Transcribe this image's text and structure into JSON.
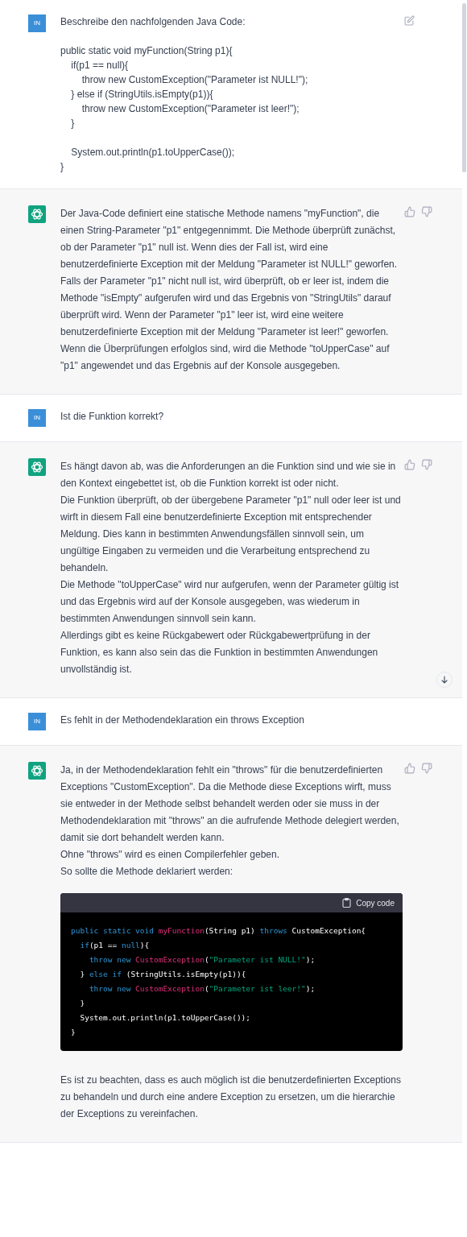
{
  "messages": [
    {
      "kind": "user",
      "avatar": "IN",
      "edit_icon": true,
      "lines": [
        "Beschreibe den nachfolgenden Java Code:"
      ],
      "code_groups": [
        [
          "public static void myFunction(String p1){",
          "    if(p1 == null){",
          "        throw new CustomException(\"Parameter ist NULL!\");",
          "    } else if (StringUtils.isEmpty(p1)){",
          "        throw new CustomException(\"Parameter ist leer!\");",
          "    }"
        ],
        [
          "    System.out.println(p1.toUpperCase());",
          "}"
        ]
      ]
    },
    {
      "kind": "assistant",
      "blocks": [
        {
          "kind": "paragraph",
          "lines": [
            "Der Java-Code definiert eine statische Methode namens \"myFunction\", die einen String-Parameter \"p1\" entgegennimmt. Die Methode überprüft zunächst, ob der Parameter \"p1\" null ist. Wenn dies der Fall ist, wird eine benutzerdefinierte Exception mit der Meldung \"Parameter ist NULL!\" geworfen. Falls der Parameter \"p1\" nicht null ist, wird überprüft, ob er leer ist, indem die Methode \"isEmpty\" aufgerufen wird und das Ergebnis von \"StringUtils\" darauf überprüft wird. Wenn der Parameter \"p1\" leer ist, wird eine weitere benutzerdefinierte Exception mit der Meldung \"Parameter ist leer!\" geworfen. Wenn die Überprüfungen erfolglos sind, wird die Methode \"toUpperCase\" auf \"p1\" angewendet und das Ergebnis auf der Konsole ausgegeben."
          ]
        }
      ]
    },
    {
      "kind": "user",
      "avatar": "IN",
      "edit_icon": false,
      "lines": [
        "Ist die Funktion korrekt?"
      ]
    },
    {
      "kind": "assistant",
      "scroll_button": true,
      "blocks": [
        {
          "kind": "paragraph",
          "lines": [
            "Es hängt davon ab, was die Anforderungen an die Funktion sind und wie sie in den Kontext eingebettet ist, ob die Funktion korrekt ist oder nicht.",
            "Die Funktion überprüft, ob der übergebene Parameter \"p1\" null oder leer ist und wirft in diesem Fall eine benutzerdefinierte Exception mit entsprechender Meldung. Dies kann in bestimmten Anwendungsfällen sinnvoll sein, um ungültige Eingaben zu vermeiden und die Verarbeitung entsprechend zu behandeln.",
            "Die Methode \"toUpperCase\" wird nur aufgerufen, wenn der Parameter gültig ist und das Ergebnis wird auf der Konsole ausgegeben, was wiederum in bestimmten Anwendungen sinnvoll sein kann.",
            "Allerdings gibt es keine Rückgabewert oder Rückgabewertprüfung in der Funktion, es kann also sein das die Funktion in bestimmten Anwendungen unvollständig ist."
          ]
        }
      ]
    },
    {
      "kind": "user",
      "avatar": "IN",
      "edit_icon": false,
      "lines": [
        "Es fehlt in der Methodendeklaration ein throws Exception"
      ]
    },
    {
      "kind": "assistant",
      "blocks": [
        {
          "kind": "paragraph",
          "lines": [
            "Ja, in der Methodendeklaration fehlt ein \"throws\" für die benutzerdefinierten Exceptions \"CustomException\". Da die Methode diese Exceptions wirft, muss sie entweder in der Methode selbst behandelt werden oder sie muss in der Methodendeklaration mit \"throws\" an die aufrufende Methode delegiert werden, damit sie dort behandelt werden kann.",
            "Ohne \"throws\" wird es einen Compilerfehler geben.",
            "So sollte die Methode deklariert werden:"
          ]
        },
        {
          "kind": "code",
          "copy_label": "Copy code",
          "code_lines": [
            [
              {
                "t": "public static void ",
                "kind": "keyword"
              },
              {
                "t": "myFunction",
                "kind": "name"
              },
              {
                "t": "(String p1) ",
                "kind": "plain"
              },
              {
                "t": "throws ",
                "kind": "keyword"
              },
              {
                "t": "CustomException{",
                "kind": "plain"
              }
            ],
            [
              {
                "t": "  if",
                "kind": "keyword"
              },
              {
                "t": "(p1 == ",
                "kind": "plain"
              },
              {
                "t": "null",
                "kind": "keyword"
              },
              {
                "t": "){",
                "kind": "plain"
              }
            ],
            [
              {
                "t": "    throw new ",
                "kind": "keyword"
              },
              {
                "t": "CustomException",
                "kind": "name"
              },
              {
                "t": "(",
                "kind": "plain"
              },
              {
                "t": "\"Parameter ist NULL!\"",
                "kind": "string"
              },
              {
                "t": ");",
                "kind": "plain"
              }
            ],
            [
              {
                "t": "  } ",
                "kind": "plain"
              },
              {
                "t": "else if ",
                "kind": "keyword"
              },
              {
                "t": "(StringUtils.isEmpty(p1)){",
                "kind": "plain"
              }
            ],
            [
              {
                "t": "    throw new ",
                "kind": "keyword"
              },
              {
                "t": "CustomException",
                "kind": "name"
              },
              {
                "t": "(",
                "kind": "plain"
              },
              {
                "t": "\"Parameter ist leer!\"",
                "kind": "string"
              },
              {
                "t": ");",
                "kind": "plain"
              }
            ],
            [
              {
                "t": "  }",
                "kind": "plain"
              }
            ],
            [
              {
                "t": "  System.out.println(p1.toUpperCase());",
                "kind": "plain"
              }
            ],
            [
              {
                "t": "}",
                "kind": "plain"
              }
            ]
          ]
        },
        {
          "kind": "paragraph",
          "lines": [
            "Es ist zu beachten, dass es auch möglich ist die benutzerdefinierten Exceptions zu behandeln und durch eine andere Exception zu ersetzen, um die hierarchie der Exceptions zu vereinfachen."
          ]
        }
      ]
    }
  ]
}
